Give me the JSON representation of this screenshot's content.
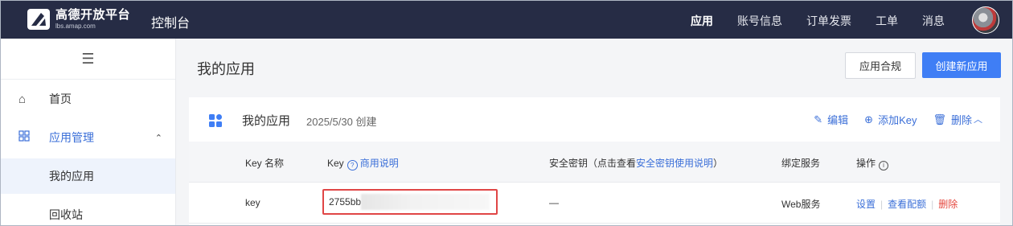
{
  "brand": {
    "name_cn": "高德开放平台",
    "name_en": "lbs.amap.com",
    "console": "控制台"
  },
  "topnav": [
    {
      "label": "应用",
      "active": true
    },
    {
      "label": "账号信息"
    },
    {
      "label": "订单发票"
    },
    {
      "label": "工单"
    },
    {
      "label": "消息"
    }
  ],
  "sidebar": {
    "toggle_glyph": "☰",
    "items": [
      {
        "label": "首页",
        "icon": "home-icon"
      },
      {
        "label": "应用管理",
        "icon": "grid-icon",
        "expanded": true
      },
      {
        "label": "我的应用",
        "selected": true
      },
      {
        "label": "回收站"
      }
    ]
  },
  "main": {
    "title": "我的应用",
    "compliance_button": "应用合规",
    "create_button": "创建新应用"
  },
  "app_card": {
    "name": "我的应用",
    "created": "2025/5/30 创建",
    "actions": {
      "edit": "编辑",
      "add_key": "添加Key",
      "delete": "删除"
    },
    "columns": {
      "key_name": "Key 名称",
      "key": "Key",
      "key_help": "商用说明",
      "secret_prefix": "安全密钥（点击查看",
      "secret_link": "安全密钥使用说明",
      "secret_suffix": "）",
      "service": "绑定服务",
      "ops": "操作"
    },
    "rows": [
      {
        "key_name": "key",
        "key": "2755bb",
        "secret": "—",
        "service": "Web服务",
        "op_settings": "设置",
        "op_quota": "查看配额",
        "op_delete": "删除"
      }
    ]
  },
  "colors": {
    "topbar": "#262c45",
    "primary": "#3f7ef5",
    "link": "#3b6fd8",
    "danger": "#e5463d",
    "highlight_box": "#e04646"
  }
}
